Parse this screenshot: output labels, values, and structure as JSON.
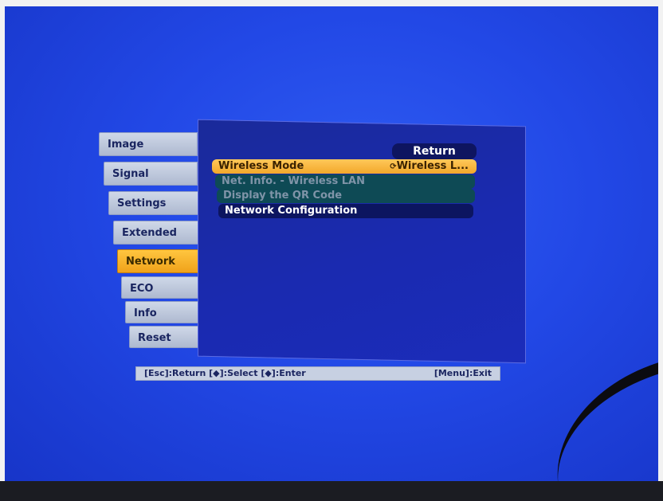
{
  "tabs": [
    {
      "label": "Image",
      "active": false
    },
    {
      "label": "Signal",
      "active": false
    },
    {
      "label": "Settings",
      "active": false
    },
    {
      "label": "Extended",
      "active": false
    },
    {
      "label": "Network",
      "active": true
    },
    {
      "label": "ECO",
      "active": false
    },
    {
      "label": "Info",
      "active": false
    },
    {
      "label": "Reset",
      "active": false
    }
  ],
  "panel": {
    "return_label": "Return",
    "rows": [
      {
        "label": "Wireless Mode",
        "value": "Wireless L...",
        "state": "selected",
        "icon": "enter-icon"
      },
      {
        "label": "Net. Info. - Wireless LAN",
        "state": "dim"
      },
      {
        "label": "Display the QR Code",
        "state": "dim"
      },
      {
        "label": "Network Configuration",
        "state": "normal"
      }
    ]
  },
  "footer": {
    "esc_hint": "[Esc]:Return",
    "select_hint": "[◆]:Select",
    "enter_hint": "[◆]:Enter",
    "menu_hint": "[Menu]:Exit"
  },
  "colors": {
    "screen_blue": "#2248e6",
    "panel_blue": "#1a2ab0",
    "highlight_orange": "#f2a82a",
    "tab_gray": "#cfd8e8"
  }
}
